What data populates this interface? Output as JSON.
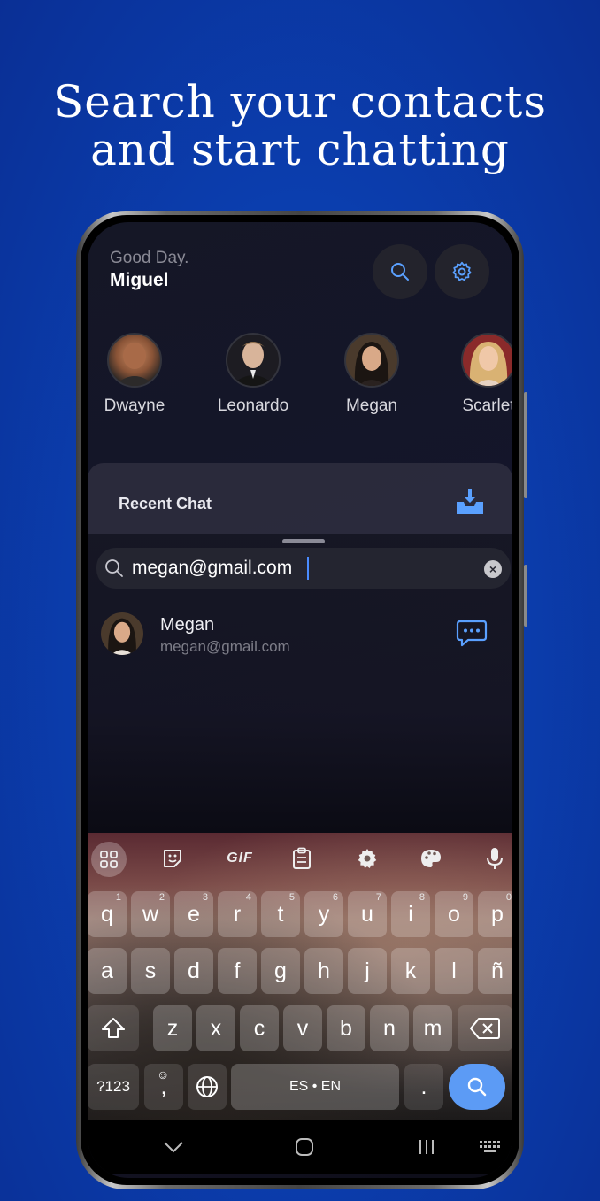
{
  "promo": {
    "line1": "Search your contacts",
    "line2": "and start chatting"
  },
  "header": {
    "greeting": "Good Day.",
    "username": "Miguel"
  },
  "contacts": [
    {
      "name": "Dwayne",
      "avatar_color": "#7a4b36"
    },
    {
      "name": "Leonardo",
      "avatar_color": "#2f2b2a"
    },
    {
      "name": "Megan",
      "avatar_color": "#3b2a22"
    },
    {
      "name": "Scarlet",
      "avatar_color": "#c89a5c"
    }
  ],
  "recent": {
    "label": "Recent Chat"
  },
  "search": {
    "value": "megan@gmail.com"
  },
  "results": [
    {
      "name": "Megan",
      "email": "megan@gmail.com"
    }
  ],
  "keyboard": {
    "toolbar": [
      "apps-grid-icon",
      "sticker-icon",
      "GIF",
      "clipboard-icon",
      "settings-icon",
      "palette-icon",
      "mic-icon"
    ],
    "gif_label": "GIF",
    "row1": [
      {
        "k": "q",
        "h": "1"
      },
      {
        "k": "w",
        "h": "2"
      },
      {
        "k": "e",
        "h": "3"
      },
      {
        "k": "r",
        "h": "4"
      },
      {
        "k": "t",
        "h": "5"
      },
      {
        "k": "y",
        "h": "6"
      },
      {
        "k": "u",
        "h": "7"
      },
      {
        "k": "i",
        "h": "8"
      },
      {
        "k": "o",
        "h": "9"
      },
      {
        "k": "p",
        "h": "0"
      }
    ],
    "row2": [
      "a",
      "s",
      "d",
      "f",
      "g",
      "h",
      "j",
      "k",
      "l",
      "ñ"
    ],
    "row3": [
      "z",
      "x",
      "c",
      "v",
      "b",
      "n",
      "m"
    ],
    "sym_key": "?123",
    "emoji_comma_key": ",",
    "space_label": "ES • EN",
    "period_key": "."
  },
  "colors": {
    "accent": "#4a8cff",
    "background": "#0b3fb0",
    "search_key": "#5c9bf5"
  }
}
